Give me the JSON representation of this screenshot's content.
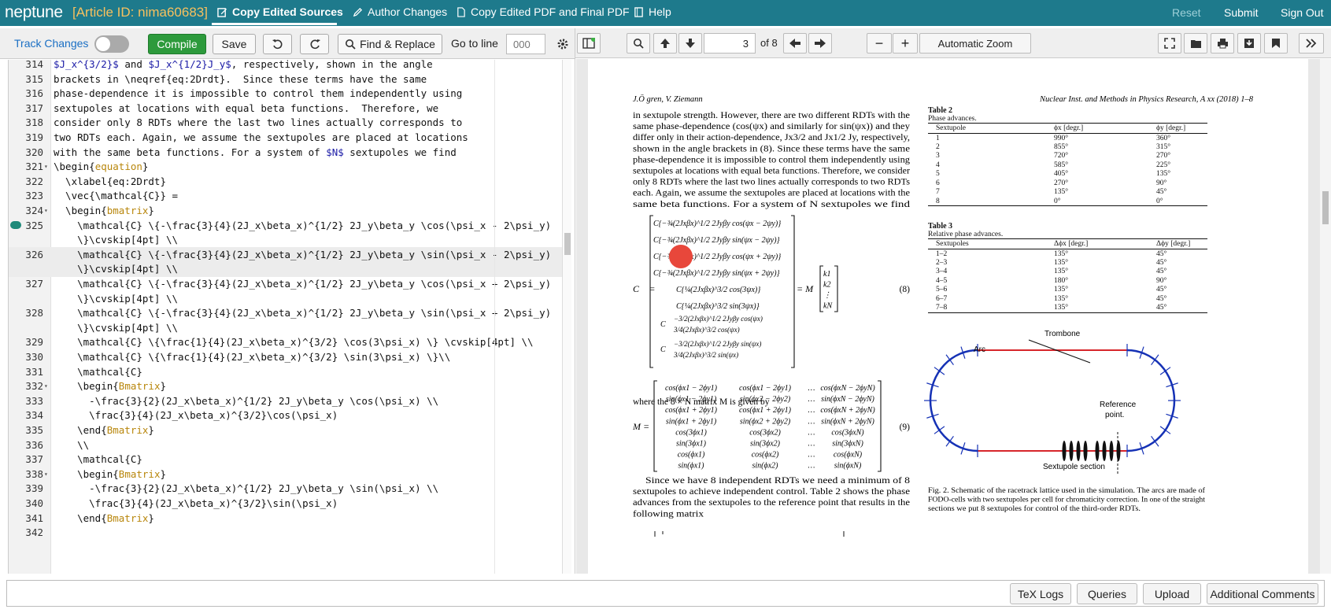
{
  "header": {
    "brand": "neptune",
    "article": "[Article ID: nima60683]",
    "tabs": [
      {
        "label": "Copy Edited Sources",
        "icon": "pencil-square-icon"
      },
      {
        "label": "Author Changes",
        "icon": "pencil-icon"
      },
      {
        "label": "Copy Edited PDF and Final PDF",
        "icon": "document-icon"
      },
      {
        "label": "Help",
        "icon": "book-icon"
      }
    ],
    "actions": {
      "reset": "Reset",
      "submit": "Submit",
      "signout": "Sign Out"
    }
  },
  "editor_toolbar": {
    "track_changes": "Track Changes",
    "compile": "Compile",
    "save": "Save",
    "find_replace": "Find & Replace",
    "goto_label": "Go to line",
    "goto_placeholder": "000"
  },
  "viewer_toolbar": {
    "page": "3",
    "of_pages": "of 8",
    "zoom": "Automatic Zoom"
  },
  "editor_lines": [
    {
      "n": "314",
      "t": "$J_x^{3/2}$ and $J_x^{1/2}J_y$, respectively, shown in the angle"
    },
    {
      "n": "315",
      "t": "brackets in \\neqref{eq:2Drdt}.  Since these terms have the same"
    },
    {
      "n": "316",
      "t": "phase-dependence it is impossible to control them independently using"
    },
    {
      "n": "317",
      "t": "sextupoles at locations with equal beta functions.  Therefore, we"
    },
    {
      "n": "318",
      "t": "consider only 8 RDTs where the last two lines actually corresponds to"
    },
    {
      "n": "319",
      "t": "two RDTs each. Again, we assume the sextupoles are placed at locations"
    },
    {
      "n": "320",
      "t": "with the same beta functions. For a system of $N$ sextupoles we find"
    },
    {
      "n": "321",
      "t": "\\begin{equation}"
    },
    {
      "n": "322",
      "t": "  \\xlabel{eq:2Drdt}"
    },
    {
      "n": "323",
      "t": "  \\vec{\\mathcal{C}} ="
    },
    {
      "n": "324",
      "t": "  \\begin{bmatrix}"
    },
    {
      "n": "325",
      "t": "    \\mathcal{C} \\{-\\frac{3}{4}(2J_x\\beta_x)^{1/2} 2J_y\\beta_y \\cos(\\psi_x - 2\\psi_y)"
    },
    {
      "n": "",
      "t": "    \\}\\cvskip[4pt] \\\\"
    },
    {
      "n": "326",
      "t": "    \\mathcal{C} \\{-\\frac{3}{4}(2J_x\\beta_x)^{1/2} 2J_y\\beta_y \\sin(\\psi_x - 2\\psi_y)"
    },
    {
      "n": "",
      "t": "    \\}\\cvskip[4pt] \\\\"
    },
    {
      "n": "327",
      "t": "    \\mathcal{C} \\{-\\frac{3}{4}(2J_x\\beta_x)^{1/2} 2J_y\\beta_y \\cos(\\psi_x + 2\\psi_y)"
    },
    {
      "n": "",
      "t": "    \\}\\cvskip[4pt] \\\\"
    },
    {
      "n": "328",
      "t": "    \\mathcal{C} \\{-\\frac{3}{4}(2J_x\\beta_x)^{1/2} 2J_y\\beta_y \\sin(\\psi_x + 2\\psi_y)"
    },
    {
      "n": "",
      "t": "    \\}\\cvskip[4pt] \\\\"
    },
    {
      "n": "329",
      "t": "    \\mathcal{C} \\{\\frac{1}{4}(2J_x\\beta_x)^{3/2} \\cos(3\\psi_x) \\} \\cvskip[4pt] \\\\"
    },
    {
      "n": "330",
      "t": "    \\mathcal{C} \\{\\frac{1}{4}(2J_x\\beta_x)^{3/2} \\sin(3\\psi_x) \\}\\\\"
    },
    {
      "n": "331",
      "t": "    \\mathcal{C}"
    },
    {
      "n": "332",
      "t": "    \\begin{Bmatrix}"
    },
    {
      "n": "333",
      "t": "      -\\frac{3}{2}(2J_x\\beta_x)^{1/2} 2J_y\\beta_y \\cos(\\psi_x) \\\\"
    },
    {
      "n": "334",
      "t": "      \\frac{3}{4}(2J_x\\beta_x)^{3/2}\\cos(\\psi_x)"
    },
    {
      "n": "335",
      "t": "    \\end{Bmatrix}"
    },
    {
      "n": "336",
      "t": "    \\\\"
    },
    {
      "n": "337",
      "t": "    \\mathcal{C}"
    },
    {
      "n": "338",
      "t": "    \\begin{Bmatrix}"
    },
    {
      "n": "339",
      "t": "      -\\frac{3}{2}(2J_x\\beta_x)^{1/2} 2J_y\\beta_y \\sin(\\psi_x) \\\\"
    },
    {
      "n": "340",
      "t": "      \\frac{3}{4}(2J_x\\beta_x)^{3/2}\\sin(\\psi_x)"
    },
    {
      "n": "341",
      "t": "    \\end{Bmatrix}"
    },
    {
      "n": "342",
      "t": ""
    }
  ],
  "pdf": {
    "header_left": "J.Ö gren, V. Ziemann",
    "header_right": "Nuclear Inst. and Methods in Physics Research, A xx (2018) 1–8",
    "para1": [
      "in sextupole strength. However, there are two different RDTs with the",
      "same phase-dependence (cos(ψx) and similarly for sin(ψx)) and they",
      "differ only in their action-dependence, Jx3/2 and Jx1/2 Jy, respectively,",
      "shown in the angle brackets in (8). Since these terms have the same",
      "phase-dependence it is impossible to control them independently using",
      "sextupoles at locations with equal beta functions. Therefore, we consider",
      "only 8 RDTs where the last two lines actually corresponds to two RDTs",
      "each. Again, we assume the sextupoles are placed at locations with the",
      "same beta functions. For a system of N sextupoles we find"
    ],
    "eq8_rows": [
      "C{−¾(2Jxβx)^1/2 2Jyβy cos(ψx − 2ψy)}",
      "C{−¾(2Jxβx)^1/2 2Jyβy sin(ψx − 2ψy)}",
      "C{−¾(2Jxβx)^1/2 2Jyβy cos(ψx + 2ψy)}",
      "C{−¾(2Jxβx)^1/2 2Jyβy sin(ψx + 2ψy)}",
      "C{¼(2Jxβx)^3/2 cos(3ψx)}",
      "C{¼(2Jxβx)^3/2 sin(3ψx)}"
    ],
    "eq8_brace1": [
      "−3/2(2Jxβx)^1/2 2Jyβy cos(ψx)",
      "3/4(2Jxβx)^3/2 cos(ψx)"
    ],
    "eq8_brace2": [
      "−3/2(2Jxβx)^1/2 2Jyβy sin(ψx)",
      "3/4(2Jxβx)^3/2 sin(ψx)"
    ],
    "eq8_lhs": "C⃗ =",
    "eq8_eq": "= M",
    "eq8_k": [
      "k1",
      "k2",
      "⋮",
      "kN"
    ],
    "eq8_num": "(8)",
    "mid_text": "where the 8 × N matrix M is given by",
    "eq9_lhs": "M =",
    "eq9_num": "(9)",
    "eq9_rows": [
      [
        "cos(ϕx1 − 2ϕy1)",
        "cos(ϕx1 − 2ϕy1)",
        "…",
        "cos(ϕxN − 2ϕyN)"
      ],
      [
        "sin(ϕx1 − 2ϕy1)",
        "sin(ϕx2 − 2ϕy2)",
        "…",
        "sin(ϕxN − 2ϕyN)"
      ],
      [
        "cos(ϕx1 + 2ϕy1)",
        "cos(ϕx1 + 2ϕy1)",
        "…",
        "cos(ϕxN + 2ϕyN)"
      ],
      [
        "sin(ϕx1 + 2ϕy1)",
        "sin(ϕx2 + 2ϕy2)",
        "…",
        "sin(ϕxN + 2ϕyN)"
      ],
      [
        "cos(3ϕx1)",
        "cos(3ϕx2)",
        "…",
        "cos(3ϕxN)"
      ],
      [
        "sin(3ϕx1)",
        "sin(3ϕx2)",
        "…",
        "sin(3ϕxN)"
      ],
      [
        "cos(ϕx1)",
        "cos(ϕx2)",
        "…",
        "cos(ϕxN)"
      ],
      [
        "sin(ϕx1)",
        "sin(ϕx2)",
        "…",
        "sin(ϕxN)"
      ]
    ],
    "para2": [
      "Since we have 8 independent RDTs we need a minimum of 8",
      "sextupoles to achieve independent control. Table 2 shows the phase",
      "advances from the sextupoles to the reference point that results in the",
      "following matrix"
    ],
    "table2": {
      "title": "Table 2",
      "caption": "Phase advances.",
      "headers": [
        "Sextupole",
        "ϕx [degr.]",
        "ϕy [degr.]"
      ],
      "rows": [
        [
          "1",
          "990°",
          "360°"
        ],
        [
          "2",
          "855°",
          "315°"
        ],
        [
          "3",
          "720°",
          "270°"
        ],
        [
          "4",
          "585°",
          "225°"
        ],
        [
          "5",
          "405°",
          "135°"
        ],
        [
          "6",
          "270°",
          "90°"
        ],
        [
          "7",
          "135°",
          "45°"
        ],
        [
          "8",
          "0°",
          "0°"
        ]
      ]
    },
    "table3": {
      "title": "Table 3",
      "caption": "Relative phase advances.",
      "headers": [
        "Sextupoles",
        "Δϕx [degr.]",
        "Δϕy [degr.]"
      ],
      "rows": [
        [
          "1–2",
          "135°",
          "45°"
        ],
        [
          "2–3",
          "135°",
          "45°"
        ],
        [
          "3–4",
          "135°",
          "45°"
        ],
        [
          "4–5",
          "180°",
          "90°"
        ],
        [
          "5–6",
          "135°",
          "45°"
        ],
        [
          "6–7",
          "135°",
          "45°"
        ],
        [
          "7–8",
          "135°",
          "45°"
        ]
      ]
    },
    "figure": {
      "label_trombone": "Trombone",
      "label_arc": "Arc",
      "label_ref1": "Reference",
      "label_ref2": "point.",
      "label_sext": "Sextupole section",
      "caption": [
        "Fig. 2.  Schematic of the racetrack lattice used in the simulation. The arcs are made of",
        "FODO-cells with two sextupoles per cell for chromaticity correction. In one of the straight",
        "sections we put 8 sextupoles for control of the third-order RDTs."
      ]
    }
  },
  "footer": {
    "tex_logs": "TeX Logs",
    "queries": "Queries",
    "upload": "Upload",
    "additional_comments": "Additional Comments"
  }
}
